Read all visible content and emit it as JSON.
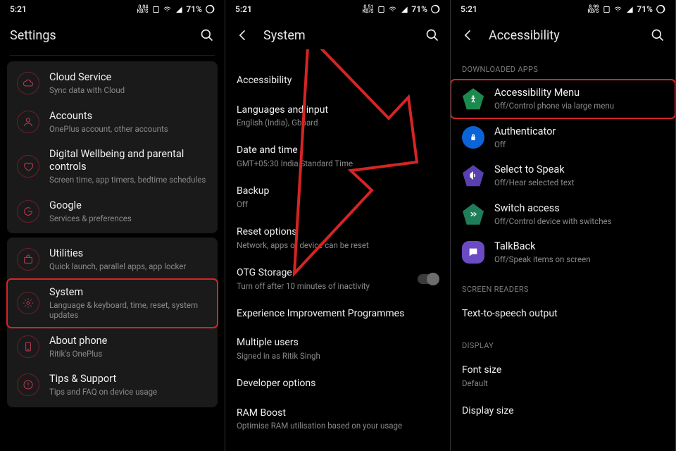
{
  "status": {
    "time": "5:21",
    "battery": "71%",
    "kbs1": "0.04",
    "kbs2": "0.51",
    "kbs3": "8.99",
    "kbs_unit": "KB/S"
  },
  "screen1": {
    "title": "Settings",
    "group1": [
      {
        "title": "Cloud Service",
        "sub": "Sync data with Cloud",
        "icon": "cloud"
      },
      {
        "title": "Accounts",
        "sub": "OnePlus account, other accounts",
        "icon": "user"
      },
      {
        "title": "Digital Wellbeing and parental controls",
        "sub": "Screen time, app timers, bedtime schedules",
        "icon": "heart"
      },
      {
        "title": "Google",
        "sub": "Services & preferences",
        "icon": "g"
      }
    ],
    "group2": [
      {
        "title": "Utilities",
        "sub": "Quick launch, parallel apps, app locker",
        "icon": "bag"
      },
      {
        "title": "System",
        "sub": "Language & keyboard, time, reset, system updates",
        "icon": "gear",
        "highlight": true
      },
      {
        "title": "About phone",
        "sub": "Ritik's OnePlus",
        "icon": "phone"
      },
      {
        "title": "Tips & Support",
        "sub": "Tips and FAQ on device usage",
        "icon": "tips"
      }
    ]
  },
  "screen2": {
    "title": "System",
    "items": [
      {
        "title": "Accessibility",
        "sub": ""
      },
      {
        "title": "Languages and input",
        "sub": "English (India), Gboard"
      },
      {
        "title": "Date and time",
        "sub": "GMT+05:30 India Standard Time"
      },
      {
        "title": "Backup",
        "sub": "Off"
      },
      {
        "title": "Reset options",
        "sub": "Network, apps or device can be reset"
      },
      {
        "title": "OTG Storage",
        "sub": "Turn off after 10 minutes of inactivity",
        "toggle": true
      },
      {
        "title": "Experience Improvement Programmes",
        "sub": ""
      },
      {
        "title": "Multiple users",
        "sub": "Signed in as Ritik Singh"
      },
      {
        "title": "Developer options",
        "sub": ""
      },
      {
        "title": "RAM Boost",
        "sub": "Optimise RAM utilisation based on your usage"
      }
    ]
  },
  "screen3": {
    "title": "Accessibility",
    "section1": "DOWNLOADED APPS",
    "apps": [
      {
        "title": "Accessibility Menu",
        "sub": "Off/Control phone via large menu",
        "icon": "pent-green",
        "highlight": true
      },
      {
        "title": "Authenticator",
        "sub": "Off",
        "icon": "circle-blue"
      },
      {
        "title": "Select to Speak",
        "sub": "Off/Hear selected text",
        "icon": "pent-purple"
      },
      {
        "title": "Switch access",
        "sub": "Off/Control device with switches",
        "icon": "pent-dgreen"
      },
      {
        "title": "TalkBack",
        "sub": "Off/Speak items on screen",
        "icon": "round-purple"
      }
    ],
    "section2": "SCREEN READERS",
    "readers": [
      {
        "title": "Text-to-speech output",
        "sub": ""
      }
    ],
    "section3": "DISPLAY",
    "display": [
      {
        "title": "Font size",
        "sub": "Default"
      },
      {
        "title": "Display size",
        "sub": ""
      }
    ]
  }
}
